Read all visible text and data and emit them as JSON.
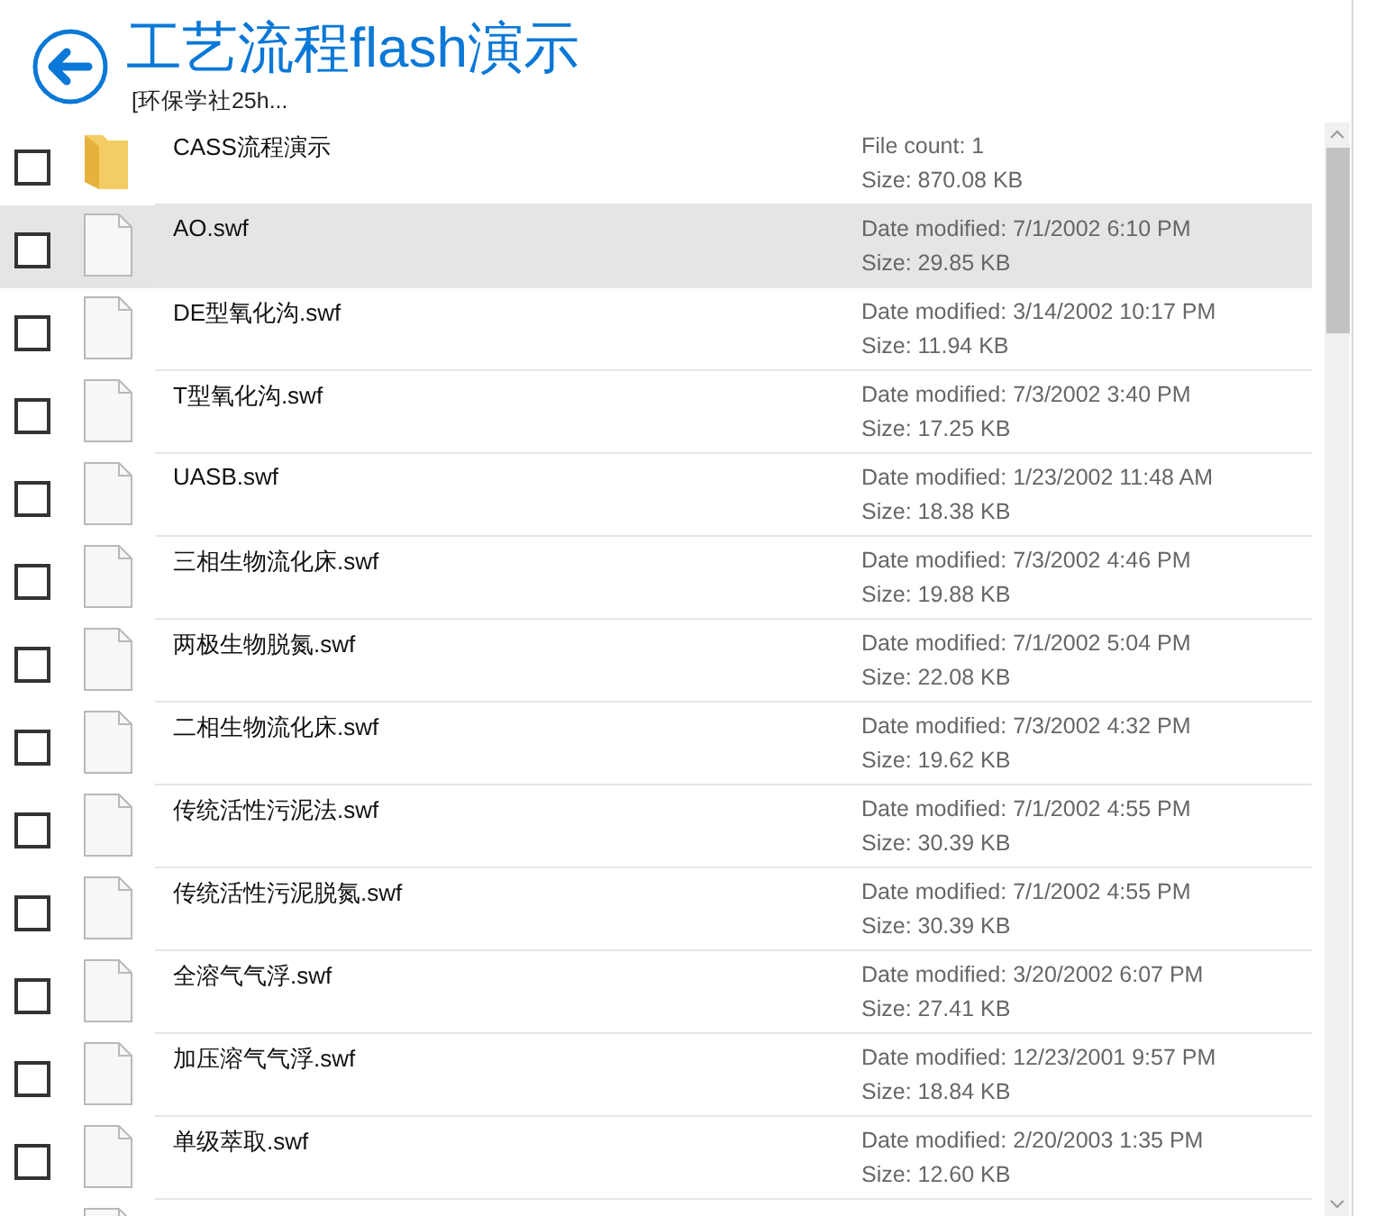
{
  "header": {
    "title": "工艺流程flash演示",
    "subtitle": "[环保学社25h..."
  },
  "items": [
    {
      "kind": "folder",
      "name": "CASS流程演示",
      "detail_1": "File count: 1",
      "detail_2": "Size: 870.08 KB",
      "selected": false,
      "checked": false
    },
    {
      "kind": "file",
      "name": "AO.swf",
      "detail_1": "Date modified: 7/1/2002 6:10 PM",
      "detail_2": "Size: 29.85 KB",
      "selected": true,
      "checked": false
    },
    {
      "kind": "file",
      "name": "DE型氧化沟.swf",
      "detail_1": "Date modified: 3/14/2002 10:17 PM",
      "detail_2": "Size: 11.94 KB",
      "selected": false,
      "checked": false
    },
    {
      "kind": "file",
      "name": "T型氧化沟.swf",
      "detail_1": "Date modified: 7/3/2002 3:40 PM",
      "detail_2": "Size: 17.25 KB",
      "selected": false,
      "checked": false
    },
    {
      "kind": "file",
      "name": "UASB.swf",
      "detail_1": "Date modified: 1/23/2002 11:48 AM",
      "detail_2": "Size: 18.38 KB",
      "selected": false,
      "checked": false
    },
    {
      "kind": "file",
      "name": "三相生物流化床.swf",
      "detail_1": "Date modified: 7/3/2002 4:46 PM",
      "detail_2": "Size: 19.88 KB",
      "selected": false,
      "checked": false
    },
    {
      "kind": "file",
      "name": "两极生物脱氮.swf",
      "detail_1": "Date modified: 7/1/2002 5:04 PM",
      "detail_2": "Size: 22.08 KB",
      "selected": false,
      "checked": false
    },
    {
      "kind": "file",
      "name": "二相生物流化床.swf",
      "detail_1": "Date modified: 7/3/2002 4:32 PM",
      "detail_2": "Size: 19.62 KB",
      "selected": false,
      "checked": false
    },
    {
      "kind": "file",
      "name": "传统活性污泥法.swf",
      "detail_1": "Date modified: 7/1/2002 4:55 PM",
      "detail_2": "Size: 30.39 KB",
      "selected": false,
      "checked": false
    },
    {
      "kind": "file",
      "name": "传统活性污泥脱氮.swf",
      "detail_1": "Date modified: 7/1/2002 4:55 PM",
      "detail_2": "Size: 30.39 KB",
      "selected": false,
      "checked": false
    },
    {
      "kind": "file",
      "name": "全溶气气浮.swf",
      "detail_1": "Date modified: 3/20/2002 6:07 PM",
      "detail_2": "Size: 27.41 KB",
      "selected": false,
      "checked": false
    },
    {
      "kind": "file",
      "name": "加压溶气气浮.swf",
      "detail_1": "Date modified: 12/23/2001 9:57 PM",
      "detail_2": "Size: 18.84 KB",
      "selected": false,
      "checked": false
    },
    {
      "kind": "file",
      "name": "单级萃取.swf",
      "detail_1": "Date modified: 2/20/2003 1:35 PM",
      "detail_2": "Size: 12.60 KB",
      "selected": false,
      "checked": false
    },
    {
      "kind": "file",
      "selected": false
    }
  ]
}
